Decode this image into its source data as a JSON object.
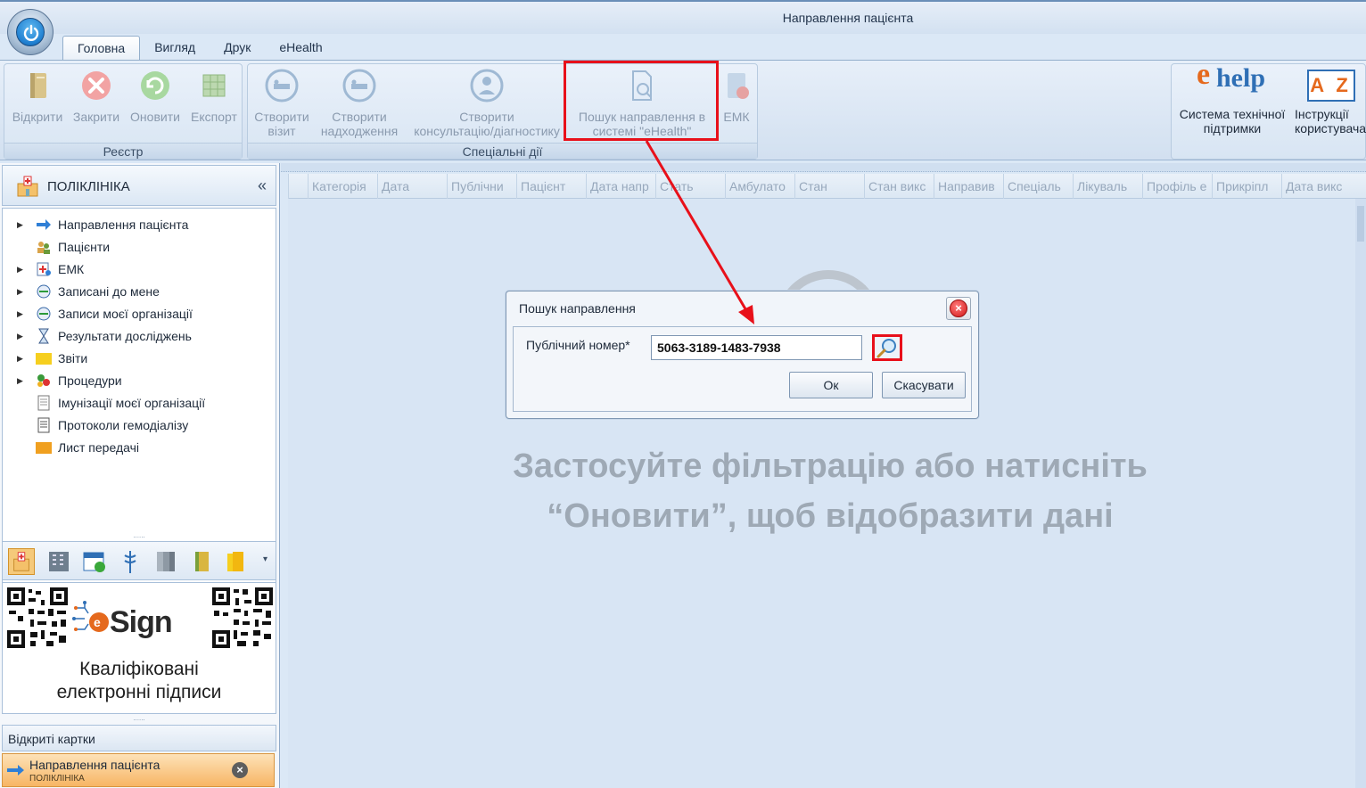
{
  "window": {
    "title": "Направлення пацієнта"
  },
  "tabs": [
    {
      "label": "Головна",
      "active": true
    },
    {
      "label": "Вигляд",
      "active": false
    },
    {
      "label": "Друк",
      "active": false
    },
    {
      "label": "eHealth",
      "active": false
    }
  ],
  "ribbon": {
    "registry": {
      "caption": "Реєстр",
      "open": "Відкрити",
      "close": "Закрити",
      "refresh": "Оновити",
      "export": "Експорт"
    },
    "special": {
      "caption": "Спеціальні дії",
      "create_visit_1": "Створити",
      "create_visit_2": "візит",
      "create_admission_1": "Створити",
      "create_admission_2": "надходження",
      "create_consult_1": "Створити",
      "create_consult_2": "консультацію/діагностику",
      "search_ehealth_1": "Пошук направлення в",
      "search_ehealth_2": "системі \"eHealth\"",
      "emk": "ЕМК"
    },
    "help": {
      "ehelp_brand": "help",
      "support_1": "Система технічної",
      "support_2": "підтримки",
      "az": "A Z",
      "manuals_1": "Інструкції",
      "manuals_2": "користувача"
    }
  },
  "nav": {
    "title": "ПОЛІКЛІНІКА",
    "collapse": "«",
    "items": [
      {
        "label": "Направлення пацієнта",
        "expandable": true,
        "icon": "arrow-right-icon"
      },
      {
        "label": "Пацієнти",
        "expandable": false,
        "icon": "patients-icon"
      },
      {
        "label": "ЕМК",
        "expandable": true,
        "icon": "emk-icon"
      },
      {
        "label": "Записані до мене",
        "expandable": true,
        "icon": "appointments-icon"
      },
      {
        "label": "Записи моєї організації",
        "expandable": true,
        "icon": "org-appointments-icon"
      },
      {
        "label": "Результати досліджень",
        "expandable": true,
        "icon": "hourglass-icon"
      },
      {
        "label": "Звіти",
        "expandable": true,
        "icon": "folder-icon"
      },
      {
        "label": "Процедури",
        "expandable": true,
        "icon": "procedures-icon"
      },
      {
        "label": "Імунізації моєї організації",
        "expandable": false,
        "icon": "document-icon"
      },
      {
        "label": "Протоколи гемодіалізу",
        "expandable": false,
        "icon": "protocol-icon"
      },
      {
        "label": "Лист передачі",
        "expandable": false,
        "icon": "folder-orange-icon"
      }
    ],
    "splitter": "......"
  },
  "banner": {
    "brand": "Sign",
    "tagline_1": "Кваліфіковані",
    "tagline_2": "електронні підписи"
  },
  "open_cards": {
    "title": "Відкриті картки",
    "card_title": "Направлення пацієнта",
    "card_sub": "ПОЛІКЛІНІКА",
    "close": "×"
  },
  "grid": {
    "columns": [
      "Категорія",
      "Дата",
      "Публічни",
      "Пацієнт",
      "Дата напр",
      "Стать",
      "Амбулато",
      "Стан",
      "Стан викс",
      "Направив",
      "Спеціаль",
      "Лікуваль",
      "Профіль е",
      "Прикріпл",
      "Дата викс"
    ],
    "empty_1": "Застосуйте фільтрацію або натисніть",
    "empty_2": "“Оновити”, щоб відобразити дані"
  },
  "dialog": {
    "title": "Пошук направлення",
    "field_label": "Публічний номер*",
    "field_value": "5063-3189-1483-7938",
    "ok": "Ок",
    "cancel": "Скасувати",
    "close": "×"
  },
  "colors": {
    "highlight": "#e8101a",
    "accent": "#1f7fd0",
    "open_card": "#f7b564"
  }
}
